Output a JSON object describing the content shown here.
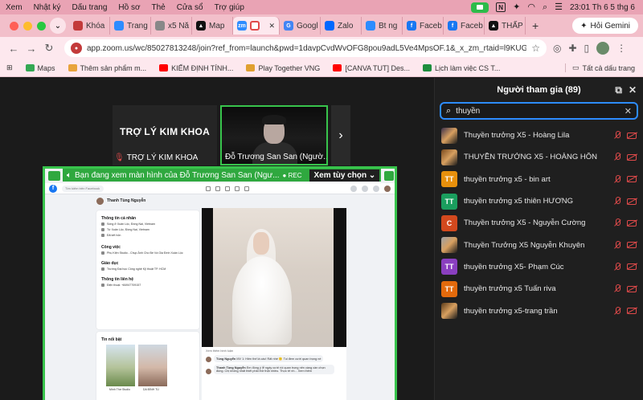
{
  "menubar": {
    "items": [
      "Xem",
      "Nhật ký",
      "Dấu trang",
      "Hồ sơ",
      "Thẻ",
      "Cửa sổ",
      "Trợ giúp"
    ],
    "clock": "23:01 Th 6 5 thg 6"
  },
  "tabs": [
    {
      "label": "Khóa",
      "color": "#c33a3a"
    },
    {
      "label": "Trang",
      "color": "#2d8cff"
    },
    {
      "label": "x5 Nă",
      "color": "#888888"
    },
    {
      "label": "Map",
      "color": "#111111"
    },
    {
      "label": "",
      "color": "#2d8cff",
      "active": true
    },
    {
      "label": "Googl",
      "color": "#4285f4"
    },
    {
      "label": "Zalo",
      "color": "#0068ff"
    },
    {
      "label": "Bt ng",
      "color": "#2d8cff"
    },
    {
      "label": "Faceb",
      "color": "#1877f2"
    },
    {
      "label": "Faceb",
      "color": "#1877f2"
    },
    {
      "label": "THẤP",
      "color": "#111111"
    }
  ],
  "gemini_label": "Hỏi Gemini",
  "omnibox": {
    "url": "app.zoom.us/wc/85027813248/join?ref_from=launch&pwd=1davpCvdWvOFG8pou9adL5Ve4MpsOF.1&_x_zm_rtaid=l9KUG7Z..."
  },
  "bookmarks": {
    "items": [
      {
        "label": "Maps",
        "color": "#34a853"
      },
      {
        "label": "Thêm sản phẩm m...",
        "color": "#e8a33c"
      },
      {
        "label": "KIẾM ĐỊNH TÍNH...",
        "color": "#ff0000"
      },
      {
        "label": "Play Together VNG",
        "color": "#e0a030"
      },
      {
        "label": "[CANVA TUT] Des...",
        "color": "#ff0000"
      },
      {
        "label": "Lịch làm việc CS T...",
        "color": "#1e8e3e"
      }
    ],
    "all_label": "Tất cả dấu trang"
  },
  "video": {
    "tile1_big": "TRỢ LÝ KIM KHOA",
    "tile1_name": "TRỢ LÝ KIM KHOA",
    "tile2_name": "Đỗ Trương San San (Ngườ..."
  },
  "share": {
    "banner": "Bạn đang xem màn hình của  Đỗ Trương San San (Ngư...",
    "rec": "REC",
    "view_options": "Xem tùy chọn"
  },
  "facebook": {
    "search_placeholder": "Tìm kiếm trên Facebook",
    "profile_name": "Thanh Tùng Nguyễn",
    "about_title": "Thông tin cá nhân",
    "about_lines": [
      "Sống ở Xuân Lộc, Đồng Nai, Vietnam",
      "Từ Xuân Lộc, Đồng Nai, Vietnam",
      "Đã kết hôn"
    ],
    "work_title": "Công việc",
    "work_line": "Phụ Kiện Studio - Chụp Ảnh Cho Bé Và Gia Đình Xuân Lộc",
    "edu_title": "Giáo dục",
    "edu_line": "Trường Đại học Công nghệ Kỹ thuật TP. HCM",
    "contact_title": "Thông tin liên hệ",
    "contact_line": "Điện thoại: +84947709157",
    "featured_title": "Tin nổi bật",
    "photo_caps": [
      "Mình Thơ Studio",
      "DA ĐÌNH TÚ"
    ],
    "comment_count": "Xem thêm bình luận",
    "comments": [
      {
        "author": "Tùng Nguyễn",
        "text": "MV 1: Hiền thế là các! Rất nhé 🙂 Tui đem cưới quan trọng nè"
      },
      {
        "author": "Thanh Tùng Nguyễn",
        "text": "Em đồng ý lễ ngày cưới rồi quan trọng nên càng cần chọn đúng. Chị không nhất thiết phải thử thật nhiều. Thực tế nh... Xem thêm"
      }
    ]
  },
  "participants": {
    "title": "Người tham gia (89)",
    "search_value": "thuyền",
    "list": [
      {
        "name": "Thuyền trưởng X5 - Hoàng Lila",
        "initials": "",
        "color": "#3a2f4a",
        "photo": true
      },
      {
        "name": "THUYỀN TRƯỞNG X5 - HOÀNG HÔN",
        "initials": "",
        "color": "#7a4a1e",
        "photo": true
      },
      {
        "name": "thuyền trưởng x5 - bin art",
        "initials": "TT",
        "color": "#e8900c"
      },
      {
        "name": "thuyền trưởng x5 thiên HƯƠNG",
        "initials": "TT",
        "color": "#1a9e5e"
      },
      {
        "name": "Thuyền trưởng X5 - Nguyễn Cường",
        "initials": "C",
        "color": "#d2491e"
      },
      {
        "name": "Thuyền Trưởng X5 Nguyễn Khuyên",
        "initials": "",
        "color": "#9aa0a8",
        "photo": true
      },
      {
        "name": "thuyền trưởng X5- Phạm Cúc",
        "initials": "TT",
        "color": "#8a3fc0"
      },
      {
        "name": "thuyền trưởng x5 Tuấn riva",
        "initials": "TT",
        "color": "#e36a0c"
      },
      {
        "name": "thuyền trưởng x5-trang trần",
        "initials": "",
        "color": "#5a3a1a",
        "photo": true
      }
    ]
  }
}
